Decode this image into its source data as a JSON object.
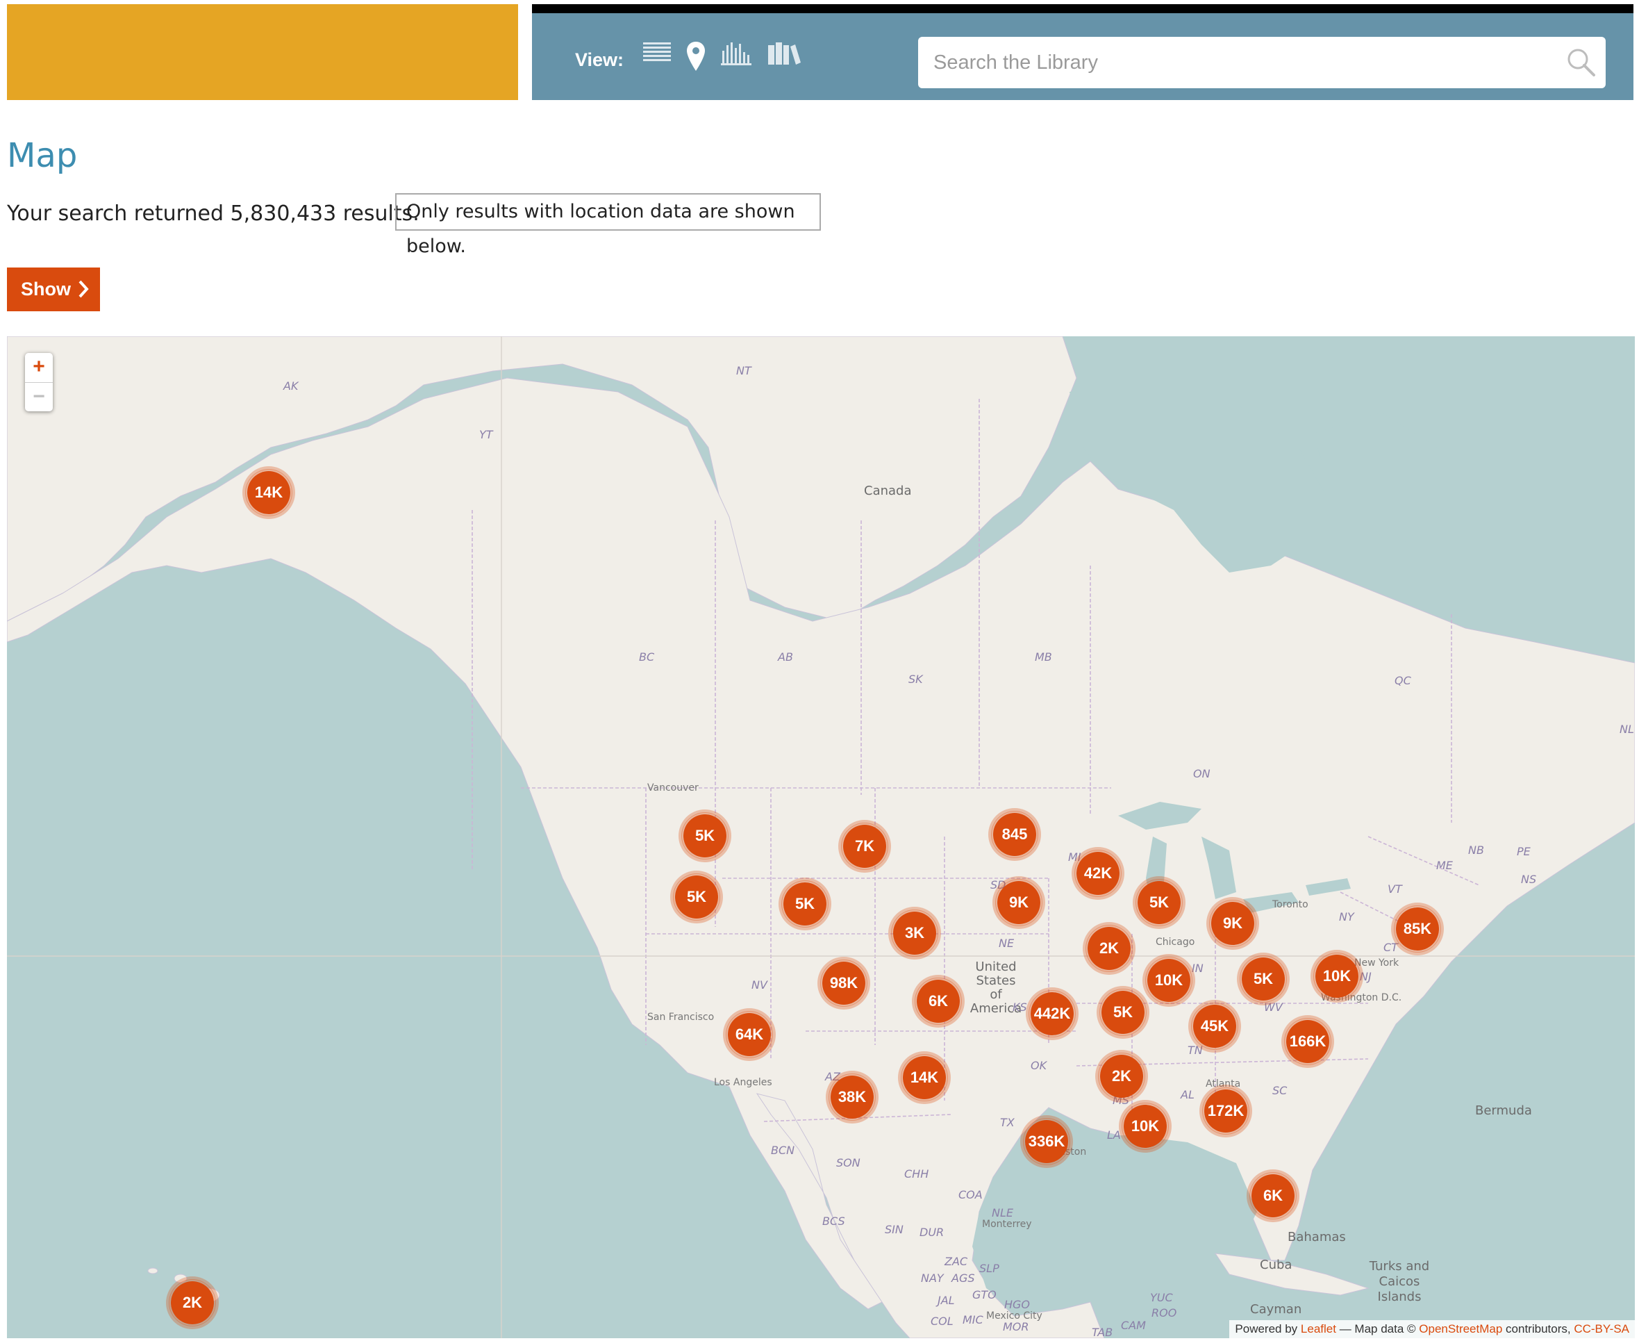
{
  "header": {
    "view_label": "View:",
    "view_icons": [
      "list-view-icon",
      "map-view-icon",
      "timeline-view-icon",
      "shelf-view-icon"
    ],
    "search": {
      "placeholder": "Search the Library",
      "value": ""
    },
    "colors": {
      "brand": "#e5a524",
      "bar": "#6693a9",
      "accent": "#d94b0e"
    }
  },
  "main": {
    "title": "Map",
    "result_text": "Your search returned 5,830,433 results.",
    "notice": "Only results with location data are shown below.",
    "show_label": "Show"
  },
  "map": {
    "zoom_in": "+",
    "zoom_out": "−",
    "labels": {
      "ak": "AK",
      "nt": "NT",
      "yt": "YT",
      "canada": "Canada",
      "bc": "BC",
      "ab": "AB",
      "sk": "SK",
      "mb": "MB",
      "qc": "QC",
      "on": "ON",
      "nb": "NB",
      "pe": "PE",
      "me": "ME",
      "ns": "NS",
      "vt": "VT",
      "ny": "NY",
      "ct": "CT",
      "nj": "NJ",
      "nl": "NL",
      "vancouver": "Vancouver",
      "toronto": "Toronto",
      "chicago": "Chicago",
      "washington": "Washington D.C.",
      "new_york": "New York",
      "nv": "NV",
      "ne": "NE",
      "in": "IN",
      "wv": "WV",
      "tn": "TN",
      "ok": "OK",
      "tx": "TX",
      "al": "AL",
      "ms": "MS",
      "la": "LA",
      "sc": "SC",
      "atlanta": "Atlanta",
      "az": "AZ",
      "san_francisco": "San Francisco",
      "los_angeles": "Los Angeles",
      "usa": "United States of America",
      "sd": "SD",
      "ks": "KS",
      "mi": "MI",
      "bermuda": "Bermuda",
      "bahamas": "Bahamas",
      "cuba": "Cuba",
      "turks": "Turks and Caicos Islands",
      "cayman": "Cayman",
      "bcn": "BCN",
      "son": "SON",
      "chh": "CHH",
      "coa": "COA",
      "nle": "NLE",
      "monterrey": "Monterrey",
      "bcs": "BCS",
      "sin": "SIN",
      "dur": "DUR",
      "zac": "ZAC",
      "slp": "SLP",
      "nay": "NAY",
      "ags": "AGS",
      "gto": "GTO",
      "jal": "JAL",
      "col": "COL",
      "mic": "MIC",
      "mex_city": "Mexico City",
      "hgo": "HGO",
      "mor": "MOR",
      "yuc": "YUC",
      "roo": "ROO",
      "cam": "CAM",
      "tab": "TAB",
      "houston": "Houston"
    },
    "clusters": [
      {
        "label": "14K"
      },
      {
        "label": "5K"
      },
      {
        "label": "7K"
      },
      {
        "label": "845"
      },
      {
        "label": "5K"
      },
      {
        "label": "5K"
      },
      {
        "label": "9K"
      },
      {
        "label": "42K"
      },
      {
        "label": "3K"
      },
      {
        "label": "5K"
      },
      {
        "label": "9K"
      },
      {
        "label": "85K"
      },
      {
        "label": "2K"
      },
      {
        "label": "98K"
      },
      {
        "label": "10K"
      },
      {
        "label": "5K"
      },
      {
        "label": "10K"
      },
      {
        "label": "6K"
      },
      {
        "label": "442K"
      },
      {
        "label": "5K"
      },
      {
        "label": "45K"
      },
      {
        "label": "64K"
      },
      {
        "label": "166K"
      },
      {
        "label": "14K"
      },
      {
        "label": "2K"
      },
      {
        "label": "38K"
      },
      {
        "label": "172K"
      },
      {
        "label": "10K"
      },
      {
        "label": "336K"
      },
      {
        "label": "6K"
      },
      {
        "label": "2K"
      }
    ],
    "attribution": {
      "prefix": "Powered by",
      "leaflet": "Leaflet",
      "middle": "— Map data ©",
      "osm": "OpenStreetMap",
      "suffix": "contributors,",
      "license": "CC-BY-SA"
    }
  }
}
